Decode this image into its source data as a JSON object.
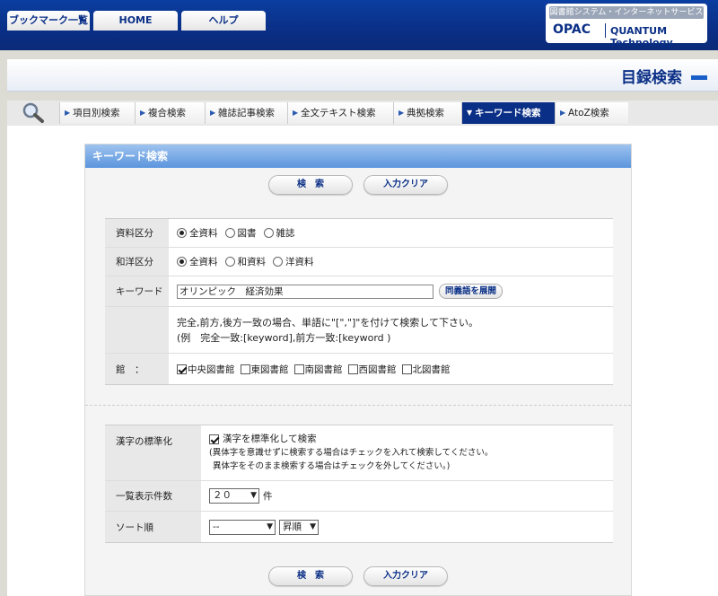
{
  "topnav": {
    "bookmarks": "ブックマーク一覧",
    "home": "HOME",
    "help": "ヘルプ"
  },
  "brand": {
    "subtitle": "図書館システム・インターネットサービス",
    "opac": "OPAC",
    "quantum": "QUANTUM Technology"
  },
  "page_title": "目録検索",
  "tabs": [
    {
      "label": "項目別検索"
    },
    {
      "label": "複合検索"
    },
    {
      "label": "雑誌記事検索"
    },
    {
      "label": "全文テキスト検索"
    },
    {
      "label": "典拠検索"
    },
    {
      "label": "キーワード検索",
      "active": true
    },
    {
      "label": "AtoZ検索"
    }
  ],
  "panel": {
    "title": "キーワード検索",
    "search_btn": "検　索",
    "clear_btn": "入力クリア",
    "material": {
      "label": "資料区分",
      "options": [
        "全資料",
        "図書",
        "雑誌"
      ],
      "selected": "全資料"
    },
    "language": {
      "label": "和洋区分",
      "options": [
        "全資料",
        "和資料",
        "洋資料"
      ],
      "selected": "全資料"
    },
    "keyword": {
      "label": "キーワード",
      "value": "オリンピック　経済効果",
      "synonym_btn": "同義語を展開"
    },
    "note1": "完全,前方,後方一致の場合、単語に\"[\",\"]\"を付けて検索して下さい。",
    "note2": "(例　完全一致:[keyword],前方一致:[keyword )",
    "library": {
      "label": "館　：",
      "options": [
        {
          "name": "中央図書館",
          "checked": true
        },
        {
          "name": "東図書館",
          "checked": false
        },
        {
          "name": "南図書館",
          "checked": false
        },
        {
          "name": "西図書館",
          "checked": false
        },
        {
          "name": "北図書館",
          "checked": false
        }
      ]
    },
    "kanji": {
      "label": "漢字の標準化",
      "check_label": "漢字を標準化して検索",
      "checked": true,
      "help1": "(異体字を意識せずに検索する場合はチェックを入れて検索してください。",
      "help2": "異体字をそのまま検索する場合はチェックを外してください。)"
    },
    "count": {
      "label": "一覧表示件数",
      "value": "２０",
      "unit": "件"
    },
    "sort": {
      "label": "ソート順",
      "value": "--",
      "order": "昇順"
    }
  },
  "colors": {
    "header": "#0a2f86",
    "accent": "#1a5fc8",
    "panel_head": "#6fa3e3"
  }
}
